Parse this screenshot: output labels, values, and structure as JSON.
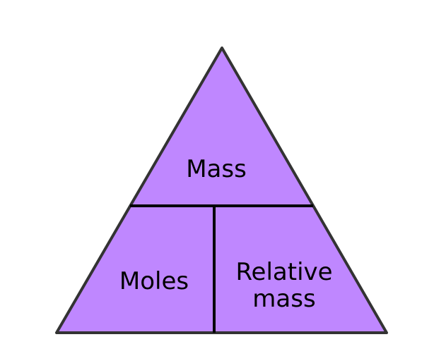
{
  "diagram": {
    "fill_color": "#bf87ff",
    "stroke_color": "#333333",
    "divider_color": "#000000",
    "sections": {
      "top": {
        "label": "Mass"
      },
      "bottom_left": {
        "label": "Moles"
      },
      "bottom_right": {
        "line1": "Relative",
        "line2": "mass"
      }
    }
  }
}
